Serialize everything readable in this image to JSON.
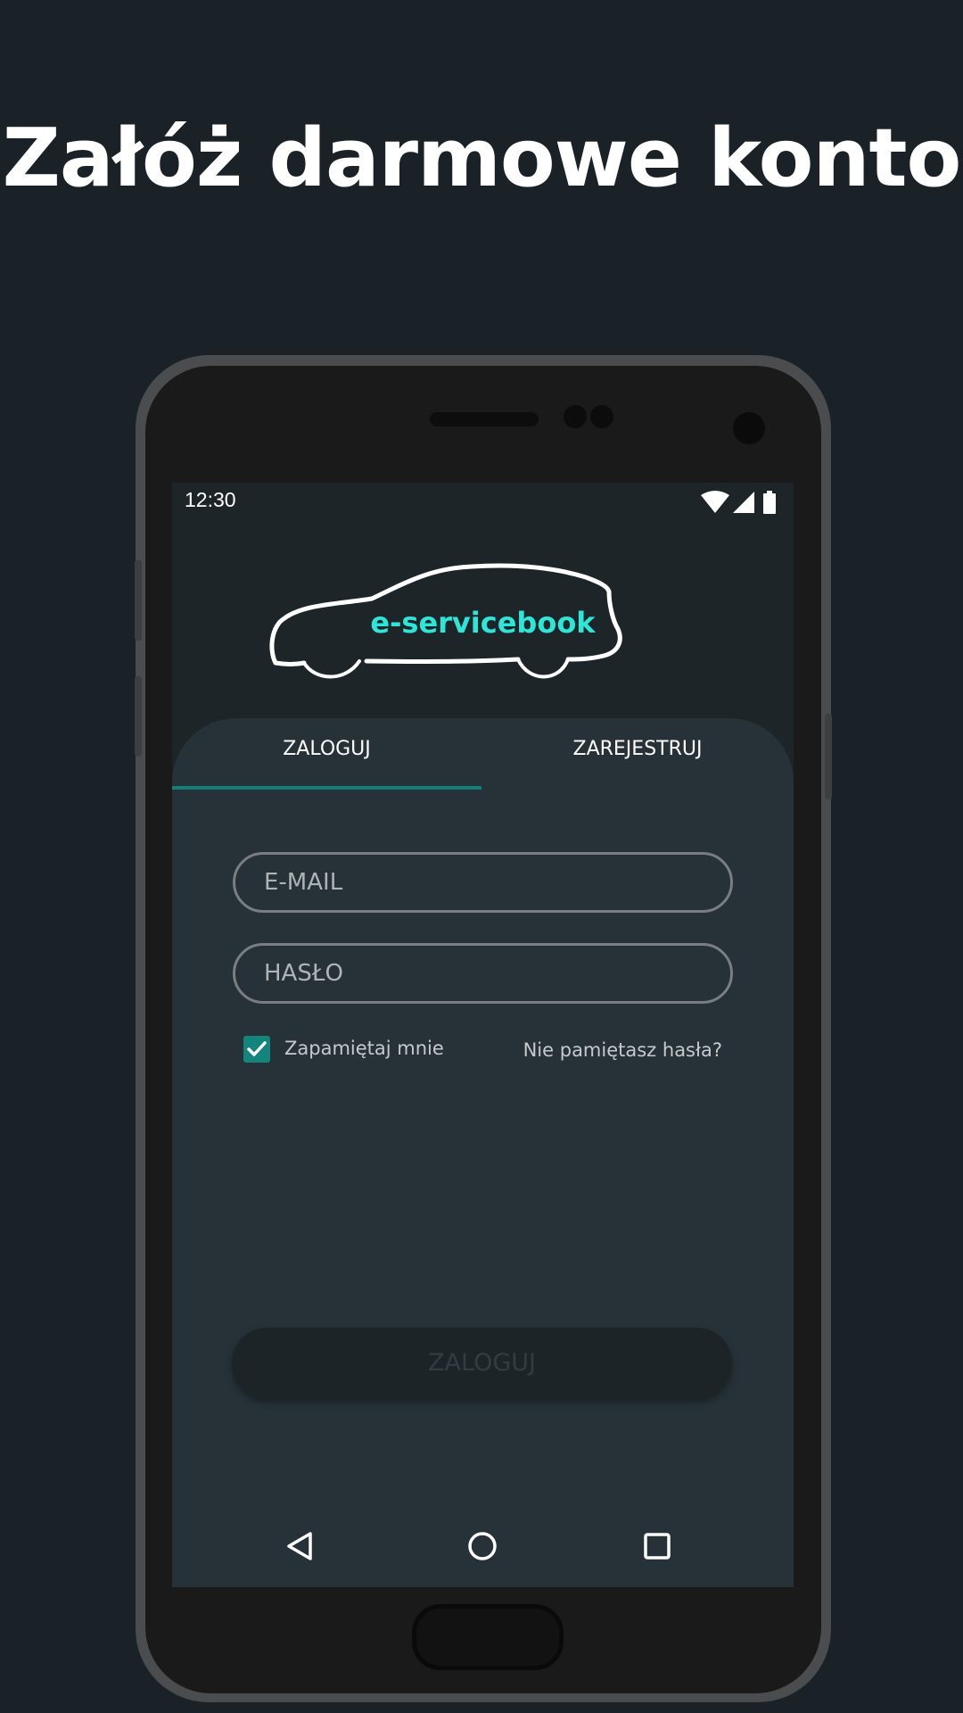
{
  "headline": "Załóż darmowe konto",
  "status_bar": {
    "time": "12:30",
    "icons": [
      "wifi-icon",
      "signal-icon",
      "battery-icon"
    ]
  },
  "app": {
    "logo_text": "e-servicebook",
    "accent_color": "#2ee6d8"
  },
  "tabs": [
    {
      "label": "ZALOGUJ",
      "selected": true
    },
    {
      "label": "ZAREJESTRUJ",
      "selected": false
    }
  ],
  "form": {
    "email_placeholder": "E-MAIL",
    "password_placeholder": "HASŁO",
    "remember_label": "Zapamiętaj mnie",
    "remember_checked": true,
    "forgot_label": "Nie pamiętasz hasła?",
    "submit_label": "ZALOGUJ"
  },
  "nav": [
    "back-icon",
    "home-icon",
    "recents-icon"
  ]
}
